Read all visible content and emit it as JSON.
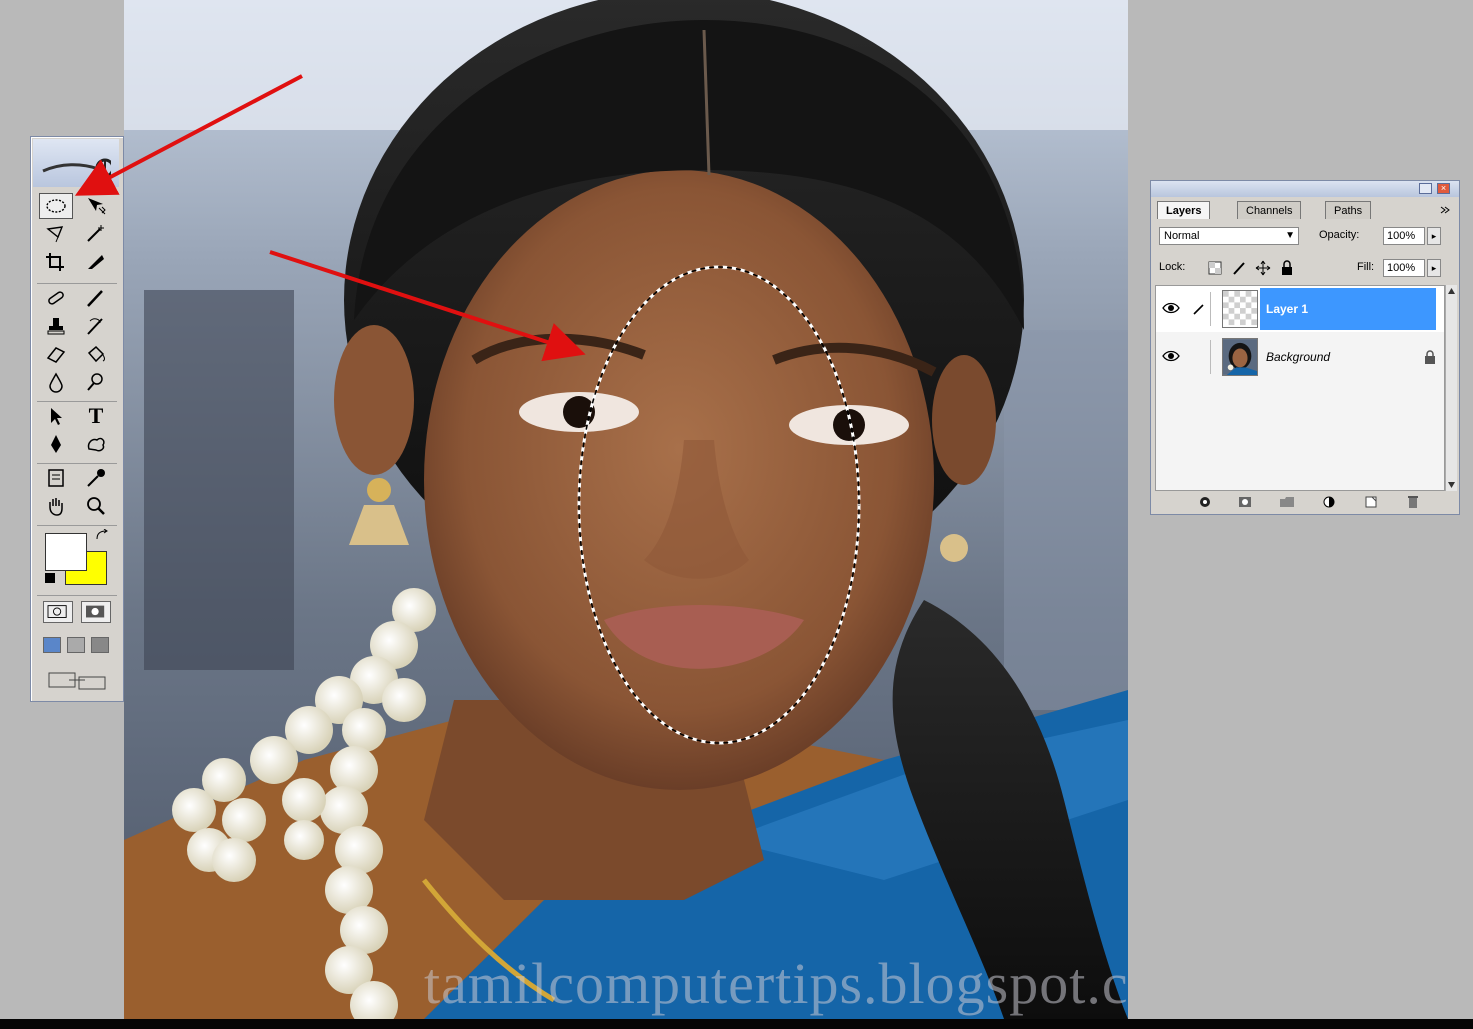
{
  "colors": {
    "workspace": "#b9b9b9",
    "foreground": "#ffffff",
    "background": "#ffff00",
    "selected_layer": "#3d97ff",
    "arrow": "#e01010"
  },
  "toolbox": {
    "tools": [
      {
        "name": "elliptical-marquee-tool-icon",
        "active": true
      },
      {
        "name": "move-tool-icon"
      },
      {
        "name": "lasso-tool-icon"
      },
      {
        "name": "magic-wand-tool-icon"
      },
      {
        "name": "crop-tool-icon"
      },
      {
        "name": "slice-tool-icon"
      },
      {
        "name": "healing-brush-tool-icon"
      },
      {
        "name": "brush-tool-icon"
      },
      {
        "name": "clone-stamp-tool-icon"
      },
      {
        "name": "history-brush-tool-icon"
      },
      {
        "name": "eraser-tool-icon"
      },
      {
        "name": "paint-bucket-tool-icon"
      },
      {
        "name": "blur-tool-icon"
      },
      {
        "name": "dodge-tool-icon"
      },
      {
        "name": "path-selection-tool-icon"
      },
      {
        "name": "type-tool-icon"
      },
      {
        "name": "pen-tool-icon"
      },
      {
        "name": "custom-shape-tool-icon"
      },
      {
        "name": "notes-tool-icon"
      },
      {
        "name": "eyedropper-tool-icon"
      },
      {
        "name": "hand-tool-icon"
      },
      {
        "name": "zoom-tool-icon"
      }
    ],
    "type_tool_glyph": "T"
  },
  "layers_palette": {
    "tabs": [
      {
        "label": "Layers",
        "active": true
      },
      {
        "label": "Channels",
        "active": false
      },
      {
        "label": "Paths",
        "active": false
      }
    ],
    "blend_mode": "Normal",
    "opacity_label": "Opacity:",
    "opacity_value": "100%",
    "lock_label": "Lock:",
    "fill_label": "Fill:",
    "fill_value": "100%",
    "layers": [
      {
        "name": "Layer 1",
        "selected": true,
        "visible": true
      },
      {
        "name": "Background",
        "selected": false,
        "visible": true,
        "locked": true
      }
    ]
  },
  "document": {
    "watermark": "tamilcomputertips.blogspot.com"
  }
}
